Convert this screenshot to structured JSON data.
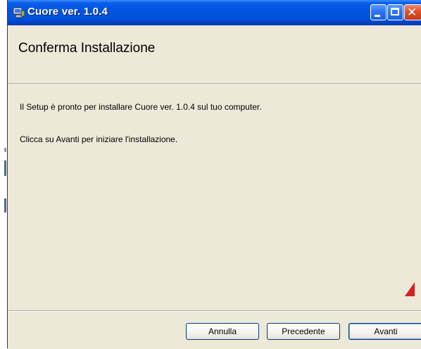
{
  "window": {
    "title": "Cuore ver. 1.0.4",
    "controls": [
      "minimize",
      "maximize",
      "close"
    ]
  },
  "header": {
    "title": "Conferma Installazione"
  },
  "content": {
    "line1": "Il Setup è pronto per installare Cuore ver. 1.0.4 sul tuo computer.",
    "line2": "Clicca su Avanti per iniziare l'installazione."
  },
  "buttons": {
    "cancel": "Annulla",
    "back": "Precedente",
    "next": "Avanti"
  },
  "colors": {
    "titlebar": "#0054e3",
    "dialog_bg": "#ece9d8",
    "close_button": "#e0502c"
  },
  "icons": {
    "app": "installer-computer-icon",
    "minimize": "minimize-icon",
    "maximize": "maximize-icon",
    "close": "close-icon"
  }
}
